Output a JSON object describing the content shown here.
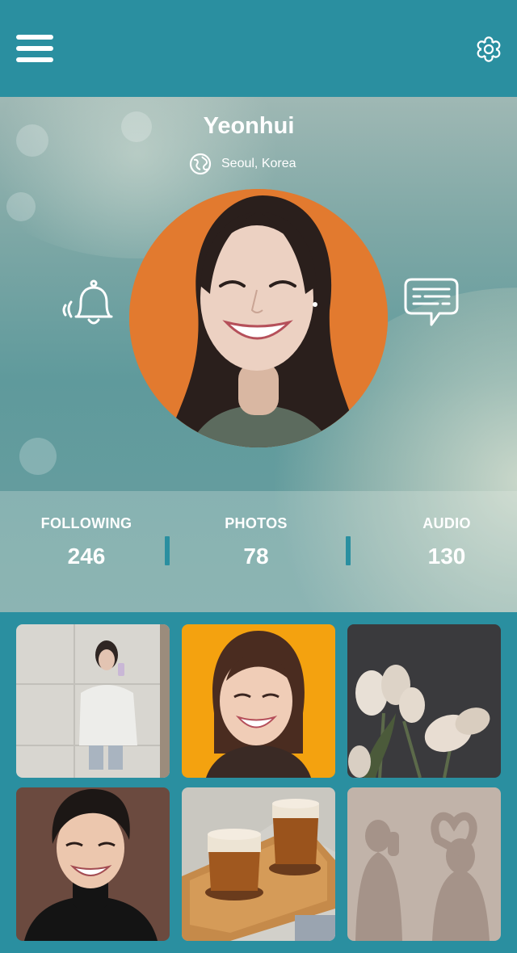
{
  "profile": {
    "name": "Yeonhui",
    "location": "Seoul, Korea"
  },
  "stats": [
    {
      "label": "FOLLOWING",
      "value": "246"
    },
    {
      "label": "PHOTOS",
      "value": "78"
    },
    {
      "label": "AUDIO",
      "value": "130"
    }
  ],
  "icons": {
    "menu": "hamburger-menu-icon",
    "settings": "gear-icon",
    "location": "globe-icon",
    "notifications": "bell-icon",
    "messages": "chat-bubble-icon"
  },
  "photos": [
    {
      "subject": "mirror selfie"
    },
    {
      "subject": "smiling woman on yellow"
    },
    {
      "subject": "tulips"
    },
    {
      "subject": "smiling man in black turtleneck"
    },
    {
      "subject": "two coffee drinks on tray"
    },
    {
      "subject": "shadow silhouettes making heart"
    }
  ],
  "colors": {
    "accent": "#2a8fa0",
    "text": "#ffffff"
  }
}
